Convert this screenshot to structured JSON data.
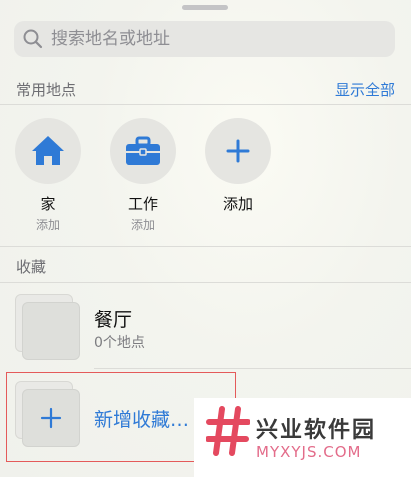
{
  "search": {
    "placeholder": "搜索地名或地址"
  },
  "frequent": {
    "title": "常用地点",
    "show_all": "显示全部",
    "items": [
      {
        "name": "家",
        "sub": "添加",
        "icon": "home-icon"
      },
      {
        "name": "工作",
        "sub": "添加",
        "icon": "briefcase-icon"
      },
      {
        "name": "添加",
        "sub": "",
        "icon": "plus-icon"
      }
    ]
  },
  "favorites": {
    "title": "收藏",
    "items": [
      {
        "name": "餐厅",
        "sub": "0个地点"
      }
    ],
    "new_label": "新增收藏…"
  },
  "watermark": {
    "cn": "兴业软件园",
    "en": "MYXYJS.COM"
  },
  "colors": {
    "accent": "#2f7ad6",
    "highlight_border": "#e45a5a",
    "watermark_logo": "#e4495f"
  }
}
